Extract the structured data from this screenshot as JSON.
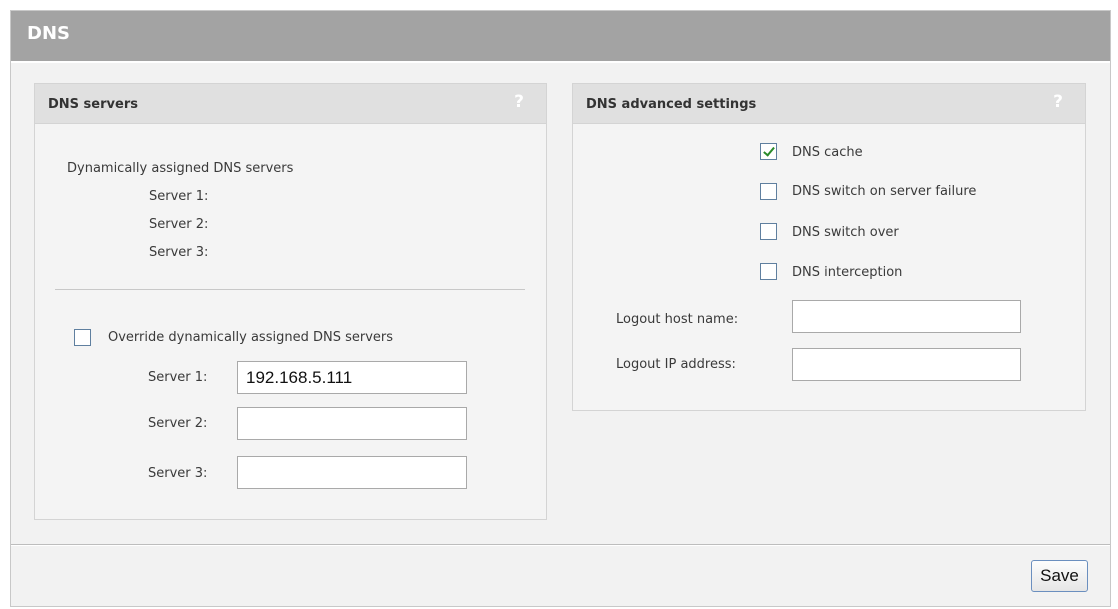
{
  "page": {
    "title": "DNS"
  },
  "dns_servers": {
    "title": "DNS servers",
    "help": "?",
    "dynamic_label": "Dynamically assigned DNS servers",
    "dynamic_servers": [
      "Server 1:",
      "Server 2:",
      "Server 3:"
    ],
    "override_label": "Override dynamically assigned DNS servers",
    "override_checked": false,
    "server1_label": "Server 1:",
    "server1_value": "192.168.5.111",
    "server2_label": "Server 2:",
    "server2_value": "",
    "server3_label": "Server 3:",
    "server3_value": ""
  },
  "advanced": {
    "title": "DNS advanced settings",
    "help": "?",
    "dns_cache_label": "DNS cache",
    "dns_cache_checked": true,
    "switch_failure_label": "DNS switch on server failure",
    "switch_failure_checked": false,
    "switch_over_label": "DNS switch over",
    "switch_over_checked": false,
    "interception_label": "DNS interception",
    "interception_checked": false,
    "logout_host_label": "Logout host name:",
    "logout_host_value": "",
    "logout_ip_label": "Logout IP address:",
    "logout_ip_value": ""
  },
  "footer": {
    "save_label": "Save"
  }
}
